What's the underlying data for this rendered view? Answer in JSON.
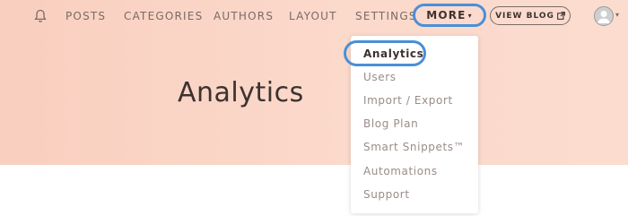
{
  "nav": {
    "items": [
      {
        "label": "POSTS"
      },
      {
        "label": "CATEGORIES"
      },
      {
        "label": "AUTHORS"
      },
      {
        "label": "LAYOUT"
      },
      {
        "label": "SETTINGS"
      }
    ],
    "more_label": "MORE",
    "view_blog_label": "VIEW BLOG"
  },
  "page": {
    "title": "Analytics"
  },
  "dropdown": {
    "items": [
      {
        "label": "Analytics"
      },
      {
        "label": "Users"
      },
      {
        "label": "Import / Export"
      },
      {
        "label": "Blog Plan"
      },
      {
        "label": "Smart Snippets™"
      },
      {
        "label": "Automations"
      },
      {
        "label": "Support"
      }
    ],
    "active_index": 0
  },
  "colors": {
    "highlight_ring": "#4a8fd8",
    "hero_gradient_start": "#f9cfbf",
    "hero_gradient_end": "#fbdccf",
    "text_dark": "#3c3230",
    "text_muted": "#9a8c88"
  },
  "icons": [
    "bell-icon",
    "external-link-icon",
    "avatar-icon",
    "caret-down-icon"
  ]
}
